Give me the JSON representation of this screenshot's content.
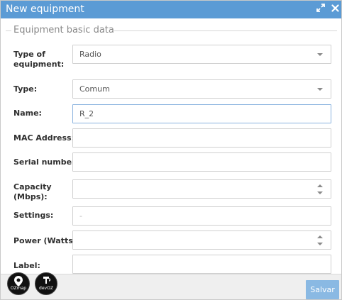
{
  "window": {
    "title": "New equipment",
    "title_bg": "#5b9bd5"
  },
  "section": {
    "legend": "Equipment basic data"
  },
  "form": {
    "type_of_equipment": {
      "label": "Type of equipment:",
      "value": "Radio"
    },
    "type": {
      "label": "Type:",
      "value": "Comum"
    },
    "name": {
      "label": "Name:",
      "value": "R_2"
    },
    "mac_address": {
      "label": "MAC Address:",
      "value": ""
    },
    "serial_number": {
      "label": "Serial number:",
      "value": ""
    },
    "capacity": {
      "label": "Capacity (Mbps):",
      "value": ""
    },
    "settings": {
      "label": "Settings:",
      "placeholder": "-"
    },
    "power": {
      "label": "Power (Watts):",
      "value": ""
    },
    "label_field": {
      "label": "Label:",
      "value": ""
    }
  },
  "footer": {
    "save_label": "Salvar",
    "save_color": "#8ab9e3",
    "logos": [
      {
        "name": "ozmap-logo",
        "text": "OZmap"
      },
      {
        "name": "devoz-logo",
        "text": "devOZ"
      }
    ]
  },
  "icons": {
    "maximize": "expand-icon",
    "close": "close-icon",
    "select_arrow": "chevron-down-icon",
    "spinner": "spinner-icon"
  }
}
